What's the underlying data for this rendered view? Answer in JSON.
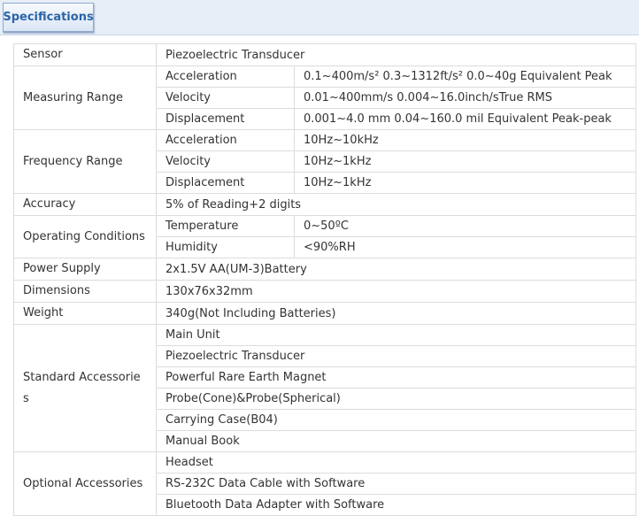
{
  "header": {
    "tab_label": "Specifications"
  },
  "rows": {
    "sensor": {
      "label": "Sensor",
      "value": "Piezoelectric Transducer"
    },
    "measuring_range": {
      "label": "Measuring Range",
      "items": [
        {
          "name": "Acceleration",
          "value": "0.1~400m/s² 0.3~1312ft/s² 0.0~40g Equivalent Peak"
        },
        {
          "name": "Velocity",
          "value": "0.01~400mm/s 0.004~16.0inch/sTrue RMS"
        },
        {
          "name": "Displacement",
          "value": "0.001~4.0 mm 0.04~160.0 mil Equivalent Peak-peak"
        }
      ]
    },
    "frequency_range": {
      "label": "Frequency Range",
      "items": [
        {
          "name": "Acceleration",
          "value": "10Hz~10kHz"
        },
        {
          "name": "Velocity",
          "value": "10Hz~1kHz"
        },
        {
          "name": "Displacement",
          "value": "10Hz~1kHz"
        }
      ]
    },
    "accuracy": {
      "label": "Accuracy",
      "value": "5% of Reading+2 digits"
    },
    "operating_conditions": {
      "label": "Operating Conditions",
      "items": [
        {
          "name": "Temperature",
          "value": "0~50ºC"
        },
        {
          "name": "Humidity",
          "value": "<90%RH"
        }
      ]
    },
    "power_supply": {
      "label": "Power Supply",
      "value": "2x1.5V AA(UM-3)Battery"
    },
    "dimensions": {
      "label": "Dimensions",
      "value": "130x76x32mm"
    },
    "weight": {
      "label": "Weight",
      "value": "340g(Not Including Batteries)"
    },
    "standard_accessories": {
      "label_line1": "Standard Accessorie",
      "label_line2": "s",
      "items": [
        "Main Unit",
        "Piezoelectric Transducer",
        "Powerful Rare Earth Magnet",
        "Probe(Cone)&Probe(Spherical)",
        "Carrying Case(B04)",
        "Manual Book"
      ]
    },
    "optional_accessories": {
      "label": "Optional Accessories",
      "items": [
        "Headset",
        "RS-232C Data Cable with Software",
        "Bluetooth Data Adapter with Software"
      ]
    }
  }
}
